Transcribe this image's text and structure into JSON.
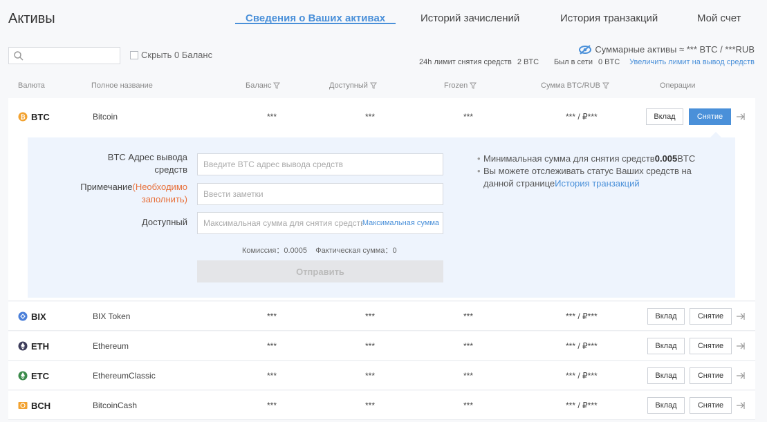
{
  "header": {
    "title": "Активы",
    "tabs": [
      {
        "label": "Сведения о Ваших активах",
        "active": true
      },
      {
        "label": "Историй зачислений",
        "active": false
      },
      {
        "label": "История транзакций",
        "active": false
      },
      {
        "label": "Мой счет",
        "active": false
      }
    ]
  },
  "toolbar": {
    "search_placeholder": "",
    "hide_zero_label": "Скрыть 0 Баланс",
    "summary_text": "Суммарные активы ≈ *** BTC / ***RUB",
    "limit_label": "24h лимит снятия средств",
    "limit_value": "2 BTC",
    "online_label": "Был в сети",
    "online_value": "0 BTC",
    "increase_link": "Увеличить лимит на вывод средств"
  },
  "table": {
    "headers": {
      "currency": "Валюта",
      "fullname": "Полное название",
      "balance": "Баланс",
      "available": "Доступный",
      "frozen": "Frozen",
      "sum": "Сумма BTC/RUB",
      "operations": "Операции"
    },
    "deposit_label": "Вклад",
    "withdraw_label": "Снятие",
    "rows": [
      {
        "coin": "BTC",
        "name": "Bitcoin",
        "balance": "***",
        "available": "***",
        "frozen": "***",
        "sum": "*** / ₽***",
        "icon_color": "#f2a230"
      },
      {
        "coin": "BIX",
        "name": "BIX Token",
        "balance": "***",
        "available": "***",
        "frozen": "***",
        "sum": "*** / ₽***",
        "icon_color": "#4a7fd9"
      },
      {
        "coin": "ETH",
        "name": "Ethereum",
        "balance": "***",
        "available": "***",
        "frozen": "***",
        "sum": "*** / ₽***",
        "icon_color": "#3c3c5a"
      },
      {
        "coin": "ETC",
        "name": "EthereumClassic",
        "balance": "***",
        "available": "***",
        "frozen": "***",
        "sum": "*** / ₽***",
        "icon_color": "#3a8a4a"
      },
      {
        "coin": "BCH",
        "name": "BitcoinCash",
        "balance": "***",
        "available": "***",
        "frozen": "***",
        "sum": "*** / ₽***",
        "icon_color": "#f2a230"
      }
    ]
  },
  "withdraw": {
    "address_label": "BTC Адрес вывода средств",
    "address_placeholder": "Введите BTC адрес вывода средств",
    "note_label": "Примечание",
    "note_required": "(Необходимо заполнить)",
    "note_placeholder": "Ввести заметки",
    "available_label": "Доступный",
    "amount_placeholder": "Максимальная сумма для снятия средств",
    "max_link": "Максимальная сумма",
    "fee_text": "Комиссия：0.0005",
    "actual_text": "Фактическая сумма：0",
    "submit_label": "Отправить",
    "min_note_prefix": "Минимальная сумма для снятия средств",
    "min_note_value": "0.005",
    "min_note_unit": "BTC",
    "track_note": "Вы можете отслеживать статус Ваших средств на данной странице",
    "track_link": "История транзакций"
  }
}
